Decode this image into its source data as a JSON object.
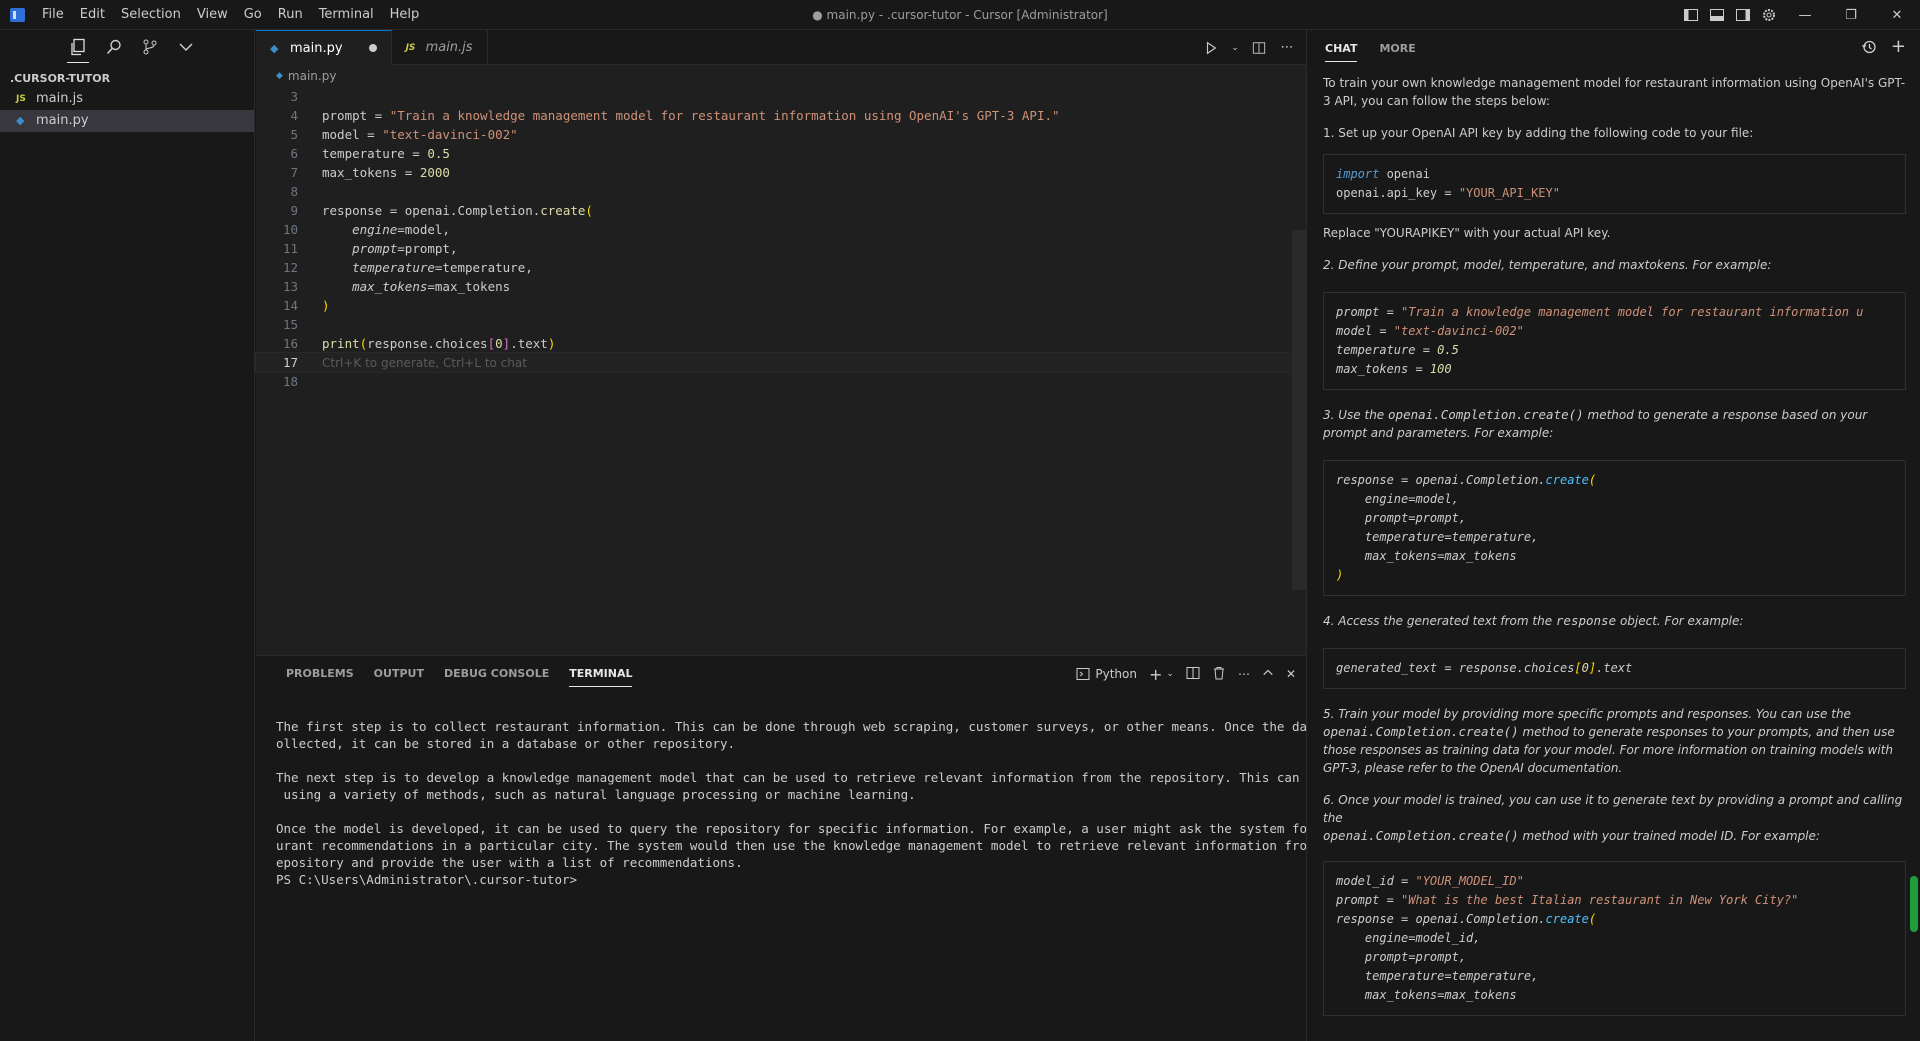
{
  "titlebar": {
    "menu": [
      "File",
      "Edit",
      "Selection",
      "View",
      "Go",
      "Run",
      "Terminal",
      "Help"
    ],
    "title": "● main.py - .cursor-tutor - Cursor [Administrator]"
  },
  "sidebar": {
    "folder": ".CURSOR-TUTOR",
    "files": [
      {
        "name": "main.js",
        "type": "js",
        "badge": "JS"
      },
      {
        "name": "main.py",
        "type": "py",
        "badge": "◆"
      }
    ]
  },
  "editor": {
    "tabs": [
      {
        "label": "main.py",
        "badge": "◆"
      },
      {
        "label": "main.js",
        "badge": "JS"
      }
    ],
    "breadcrumb": "main.py",
    "ghost_hint": "Ctrl+K to generate, Ctrl+L to chat",
    "line_numbers": [
      "3",
      "4",
      "5",
      "6",
      "7",
      "8",
      "9",
      "10",
      "11",
      "12",
      "13",
      "14",
      "15",
      "16",
      "17",
      "18"
    ],
    "code": {
      "l4a": "prompt = ",
      "l4b": "\"Train a knowledge management model for restaurant information using OpenAI's GPT-3 API.\"",
      "l5a": "model = ",
      "l5b": "\"text-davinci-002\"",
      "l6a": "temperature = ",
      "l6b": "0.5",
      "l7a": "max_tokens = ",
      "l7b": "2000",
      "l9a": "response = openai.Completion.",
      "l9b": "create",
      "l9c": "(",
      "l10a": "engine",
      "l10b": "=model,",
      "l11a": "prompt",
      "l11b": "=prompt,",
      "l12a": "temperature",
      "l12b": "=temperature,",
      "l13a": "max_tokens",
      "l13b": "=max_tokens",
      "l14": ")",
      "l16a": "print",
      "l16b": "(",
      "l16c": "response.choices",
      "l16d": "[",
      "l16e": "0",
      "l16f": "]",
      "l16g": ".text",
      "l16h": ")"
    }
  },
  "panel": {
    "tabs": [
      "PROBLEMS",
      "OUTPUT",
      "DEBUG CONSOLE",
      "TERMINAL"
    ],
    "terminal_kind": "Python",
    "terminal_lines": [
      "The first step is to collect restaurant information. This can be done through web scraping, customer surveys, or other means. Once the data is c",
      "ollected, it can be stored in a database or other repository.",
      "",
      "The next step is to develop a knowledge management model that can be used to retrieve relevant information from the repository. This can be done",
      " using a variety of methods, such as natural language processing or machine learning.",
      "",
      "Once the model is developed, it can be used to query the repository for specific information. For example, a user might ask the system for resta",
      "urant recommendations in a particular city. The system would then use the knowledge management model to retrieve relevant information from the r",
      "epository and provide the user with a list of recommendations.",
      "PS C:\\Users\\Administrator\\.cursor-tutor>"
    ]
  },
  "chat": {
    "tabs": [
      "CHAT",
      "MORE"
    ],
    "intro": "To train your own knowledge management model for restaurant information using OpenAI's GPT-3 API, you can follow the steps below:",
    "step1": "1. Set up your OpenAI API key by adding the following code to your file:",
    "code1": {
      "kw": "import",
      "l1": " openai",
      "l2a": "openai.api_key = ",
      "l2b": "\"YOUR_API_KEY\""
    },
    "replace_note": "Replace \"YOURAPIKEY\" with your actual API key.",
    "step2": "2. Define your prompt, model, temperature, and maxtokens. For example:",
    "code2": {
      "a1": "prompt = ",
      "b1": "\"Train a knowledge management model for restaurant information u",
      "a2": "model = ",
      "b2": "\"text-davinci-002\"",
      "a3": "temperature = ",
      "b3": "0.5",
      "a4": "max_tokens = ",
      "b4": "100"
    },
    "step3a": "3. Use the ",
    "step3code": "openai.Completion.create()",
    "step3b": " method to generate a response based on your prompt and parameters. For example:",
    "code3": {
      "a": "response = openai.Completion.",
      "fn": "create",
      "p": "(",
      "l2": "    engine=model,",
      "l3": "    prompt=prompt,",
      "l4": "    temperature=temperature,",
      "l5": "    max_tokens=max_tokens",
      "l6": ")"
    },
    "step4a": "4. Access the generated text from the ",
    "step4code": "response",
    "step4b": " object. For example:",
    "code4": {
      "a": "generated_text = response.choices",
      "b": "[",
      "c": "0",
      "d": "]",
      "e": ".text"
    },
    "step5a": "5. Train your model by providing more specific prompts and responses. You can use the",
    "step5code": "openai.Completion.create()",
    "step5b": " method to generate responses to your prompts, and then use those responses as training data for your model. For more information on training models with GPT-3, please refer to the OpenAI documentation.",
    "step6a": "6. Once your model is trained, you can use it to generate text by providing a prompt and calling the",
    "step6code": "openai.Completion.create()",
    "step6b": " method with your trained model ID. For example:",
    "code6": {
      "a1": "model_id = ",
      "b1": "\"YOUR_MODEL_ID\"",
      "a2": "prompt = ",
      "b2": "\"What is the best Italian restaurant in New York City?\"",
      "a3": "response = openai.Completion.",
      "fn": "create",
      "p": "(",
      "l4": "    engine=model_id,",
      "l5": "    prompt=prompt,",
      "l6": "    temperature=temperature,",
      "l7": "    max_tokens=max_tokens"
    }
  }
}
